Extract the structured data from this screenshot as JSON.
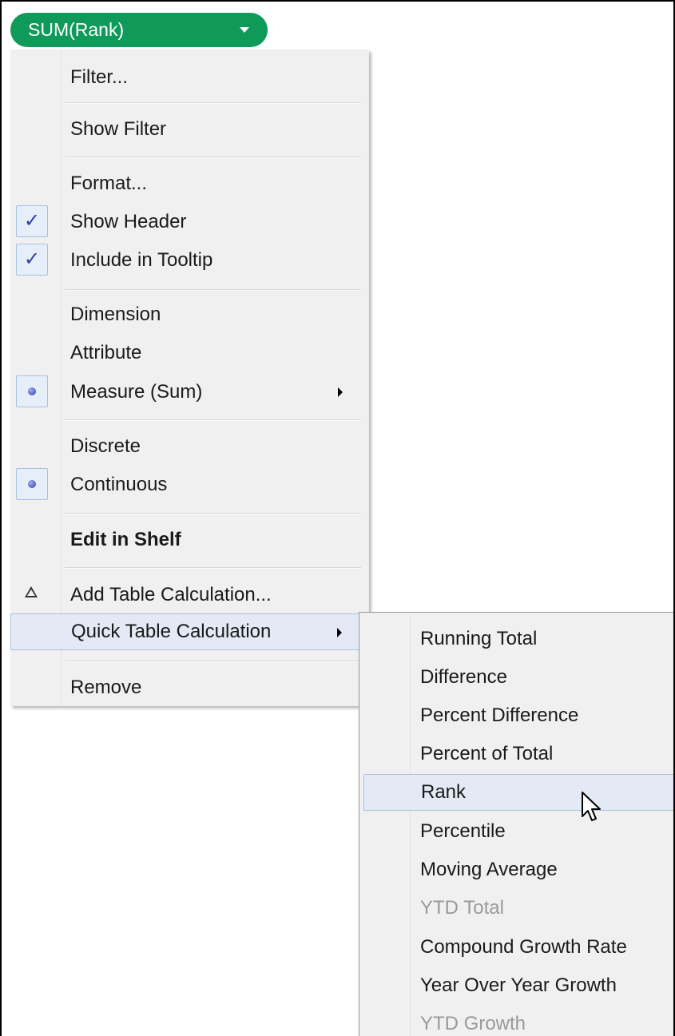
{
  "pill": {
    "label": "SUM(Rank)",
    "color": "#0f9a5a",
    "caret_icon": "caret-down-icon"
  },
  "context_menu": {
    "items": [
      {
        "label": "Filter..."
      },
      {
        "label": "Show Filter"
      },
      {
        "label": "Format..."
      },
      {
        "label": "Show Header",
        "mark": "checkmark-icon"
      },
      {
        "label": "Include in Tooltip",
        "mark": "checkmark-icon"
      },
      {
        "label": "Dimension"
      },
      {
        "label": "Attribute"
      },
      {
        "label": "Measure (Sum)",
        "mark": "radio-dot-icon",
        "submenu_icon": "chevron-right-icon"
      },
      {
        "label": "Discrete"
      },
      {
        "label": "Continuous",
        "mark": "radio-dot-icon"
      },
      {
        "label": "Edit in Shelf"
      },
      {
        "label": "Add Table Calculation...",
        "mark": "delta-icon"
      },
      {
        "label": "Quick Table Calculation",
        "submenu_icon": "chevron-right-icon",
        "highlighted": true
      },
      {
        "label": "Remove"
      }
    ]
  },
  "submenu": {
    "items": [
      {
        "label": "Running Total"
      },
      {
        "label": "Difference"
      },
      {
        "label": "Percent Difference"
      },
      {
        "label": "Percent of Total"
      },
      {
        "label": "Rank",
        "highlighted": true
      },
      {
        "label": "Percentile"
      },
      {
        "label": "Moving Average"
      },
      {
        "label": "YTD Total",
        "disabled": true
      },
      {
        "label": "Compound Growth Rate"
      },
      {
        "label": "Year Over Year Growth"
      },
      {
        "label": "YTD Growth",
        "disabled": true
      }
    ]
  },
  "colors": {
    "menu_bg": "#f0f0f0",
    "highlight": "#e3eaf6",
    "check": "#2b3fb5",
    "disabled_text": "#9a9a9a"
  }
}
